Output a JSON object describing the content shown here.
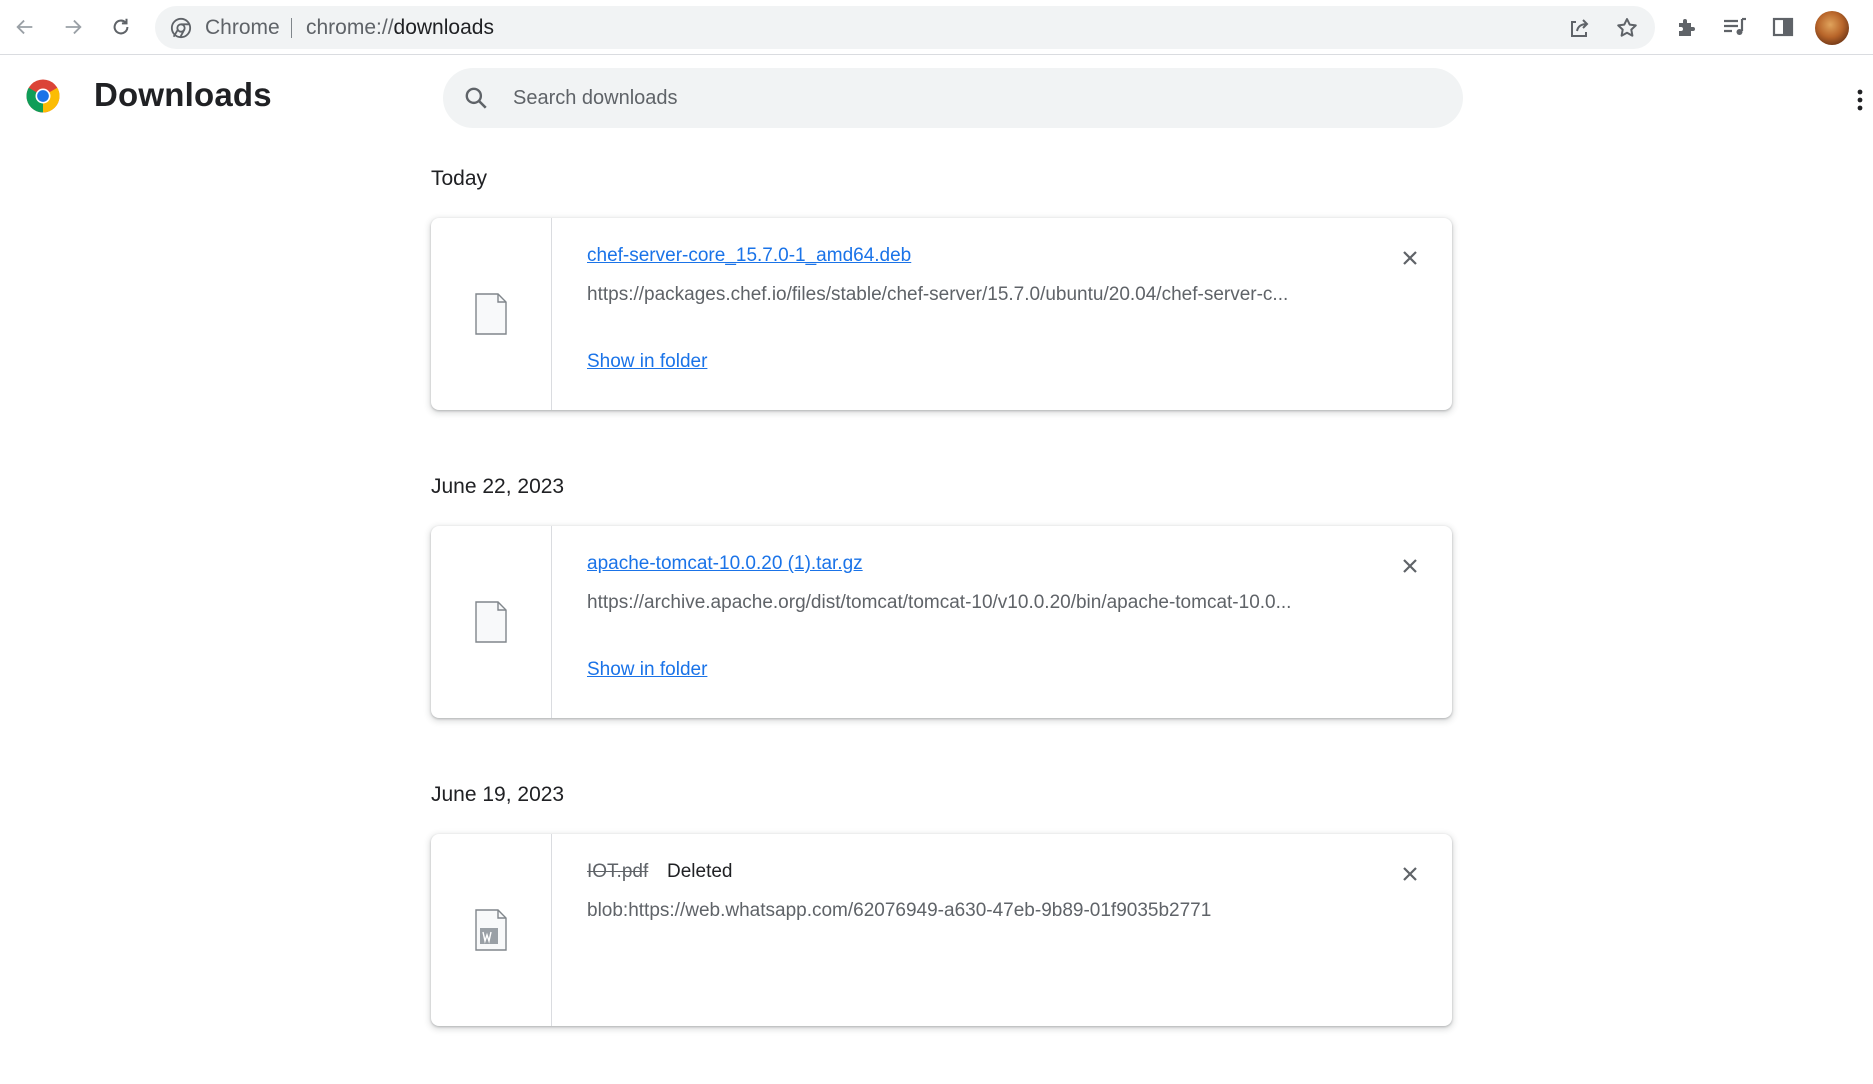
{
  "browser": {
    "omnibox_chip": "Chrome",
    "url_scheme": "chrome://",
    "url_path": "downloads"
  },
  "icons": {
    "back": "arrow-left",
    "forward": "arrow-right",
    "reload": "circular-arrow",
    "share": "share-box-arrow",
    "bookmark": "star-outline",
    "extensions": "puzzle-piece",
    "media": "playlist-music",
    "side_panel": "side-panel",
    "search": "magnifier",
    "more": "vertical-dots",
    "remove": "x-close",
    "file": "blank-document",
    "word_file": "word-document"
  },
  "header": {
    "title": "Downloads",
    "search_placeholder": "Search downloads"
  },
  "groups": [
    {
      "date": "Today",
      "items": [
        {
          "name": "chef-server-core_15.7.0-1_amd64.deb",
          "url": "https://packages.chef.io/files/stable/chef-server/15.7.0/ubuntu/20.04/chef-server-c...",
          "action": "Show in folder"
        }
      ]
    },
    {
      "date": "June 22, 2023",
      "items": [
        {
          "name": "apache-tomcat-10.0.20 (1).tar.gz",
          "url": "https://archive.apache.org/dist/tomcat/tomcat-10/v10.0.20/bin/apache-tomcat-10.0...",
          "action": "Show in folder"
        }
      ]
    },
    {
      "date": "June 19, 2023",
      "items": [
        {
          "name": "IOT.pdf",
          "status": "Deleted",
          "url": "blob:https://web.whatsapp.com/62076949-a630-47eb-9b89-01f9035b2771"
        }
      ]
    }
  ],
  "colors": {
    "link": "#1a73e8",
    "text": "#202124",
    "secondary_text": "#5f6368",
    "omnibox_bg": "#f1f3f4"
  }
}
